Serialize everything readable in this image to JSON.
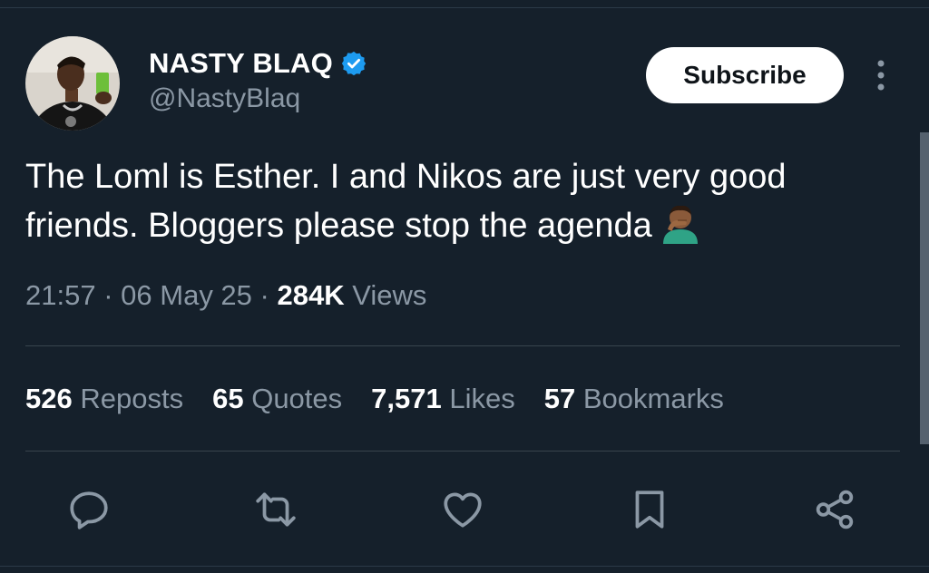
{
  "author": {
    "display_name": "NASTY BLAQ",
    "handle": "@NastyBlaq",
    "verified_icon": "verified-badge-icon",
    "avatar_icon": "profile-photo"
  },
  "header": {
    "subscribe_label": "Subscribe",
    "more_icon": "more-options-icon"
  },
  "tweet": {
    "text_line1": "The Loml is Esther. I and Nikos are just very good",
    "text_line2": "friends. Bloggers please stop the agenda",
    "emoji": "man-facepalming-emoji",
    "time": "21:57",
    "date": "06 May 25",
    "separator": "·",
    "views_count": "284K",
    "views_label": "Views"
  },
  "stats": [
    {
      "count": "526",
      "label": "Reposts"
    },
    {
      "count": "65",
      "label": "Quotes"
    },
    {
      "count": "7,571",
      "label": "Likes"
    },
    {
      "count": "57",
      "label": "Bookmarks"
    }
  ],
  "actions": [
    "reply-icon",
    "repost-icon",
    "like-icon",
    "bookmark-icon",
    "share-icon"
  ],
  "colors": {
    "background": "#15202b",
    "secondary_text": "#8b98a5",
    "verified": "#1d9bf0",
    "divider": "#38444d"
  }
}
